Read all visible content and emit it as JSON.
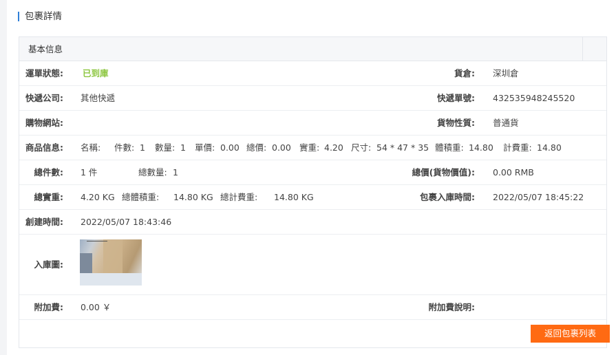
{
  "page": {
    "title": "包裹詳情"
  },
  "card": {
    "title": "基本信息"
  },
  "rows": {
    "status": {
      "label": "運單狀態:",
      "value": "已到庫",
      "status_color": "#8cc63f"
    },
    "warehouse": {
      "label": "貨倉:",
      "value": "深圳倉"
    },
    "courier": {
      "label": "快遞公司:",
      "value": "其他快遞"
    },
    "tracking": {
      "label": "快遞單號:",
      "value": "432535948245520"
    },
    "shop_site": {
      "label": "購物網站:",
      "value": ""
    },
    "goods_type": {
      "label": "貨物性質:",
      "value": "普通貨"
    },
    "product_info": {
      "label": "商品信息:",
      "name_label": "名稱:",
      "name_value": "",
      "pieces_label": "件數:",
      "pieces_value": "1",
      "qty_label": "數量:",
      "qty_value": "1",
      "unit_price_label": "單價:",
      "unit_price_value": "0.00",
      "total_price_label": "總價:",
      "total_price_value": "0.00",
      "actual_weight_label": "實重:",
      "actual_weight_value": "4.20",
      "size_label": "尺寸:",
      "size_value": "54 * 47 * 35",
      "volume_weight_label": "體積重:",
      "volume_weight_value": "14.80",
      "billed_weight_label": "計費重:",
      "billed_weight_value": "14.80"
    },
    "total_pieces": {
      "label": "總件數:",
      "value": "1 件",
      "total_qty_label": "總數量:",
      "total_qty_value": "1"
    },
    "total_value": {
      "label": "總價(貨物價值):",
      "value": "0.00 RMB"
    },
    "total_weight": {
      "label": "總實重:",
      "value": "4.20 KG",
      "volume_label": "總體積重:",
      "volume_value": "14.80 KG",
      "billed_label": "總計費重:",
      "billed_value": "14.80 KG"
    },
    "inbound_time": {
      "label": "包裹入庫時間:",
      "value": "2022/05/07 18:45:22"
    },
    "created_time": {
      "label": "創建時間:",
      "value": "2022/05/07 18:43:46"
    },
    "inbound_image": {
      "label": "入庫圖:"
    },
    "surcharge": {
      "label": "附加費:",
      "value": "0.00 ￥"
    },
    "surcharge_note": {
      "label": "附加費說明:",
      "value": ""
    }
  },
  "actions": {
    "back_label": "返回包裹列表",
    "accent": "#ff6a13"
  }
}
